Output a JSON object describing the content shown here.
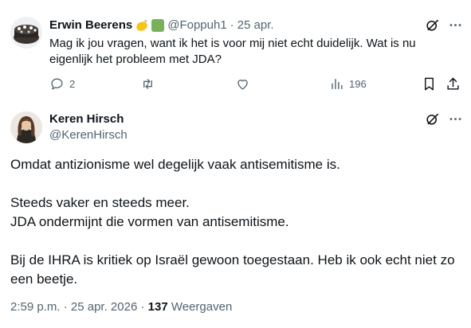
{
  "tweet1": {
    "name": "Erwin Beerens",
    "handle": "@Foppuh1",
    "separator": "·",
    "date": "25 apr.",
    "text_line1": "Mag ik jou vragen, want ik het is voor mij niet echt duidelijk. Wat is nu",
    "text_line2": "eigenlijk het probleem met JDA?",
    "replies": "2",
    "views": "196",
    "icons": [
      "grok-icon",
      "more-icon",
      "reply-icon",
      "retweet-icon",
      "like-icon",
      "views-icon",
      "bookmark-icon",
      "share-icon"
    ]
  },
  "tweet2": {
    "name": "Keren Hirsch",
    "handle": "@KerenHirsch",
    "paragraphs": [
      "Omdat antizionisme wel degelijk vaak antisemitisme is.",
      "Steeds vaker en steeds meer.",
      "JDA ondermijnt die vormen van antisemitisme.",
      "Bij de IHRA is kritiek op Israël gewoon toegestaan. Heb ik ook echt niet zo een beetje."
    ],
    "time": "2:59 p.m.",
    "separator": "·",
    "date": "25 apr. 2026",
    "views_count": "137",
    "views_label": "Weergaven",
    "icons": [
      "grok-icon",
      "more-icon"
    ]
  },
  "colors": {
    "text": "#0f1419",
    "muted": "#536471",
    "emoji_green": "#78b159",
    "lemon": "#f5c518"
  }
}
